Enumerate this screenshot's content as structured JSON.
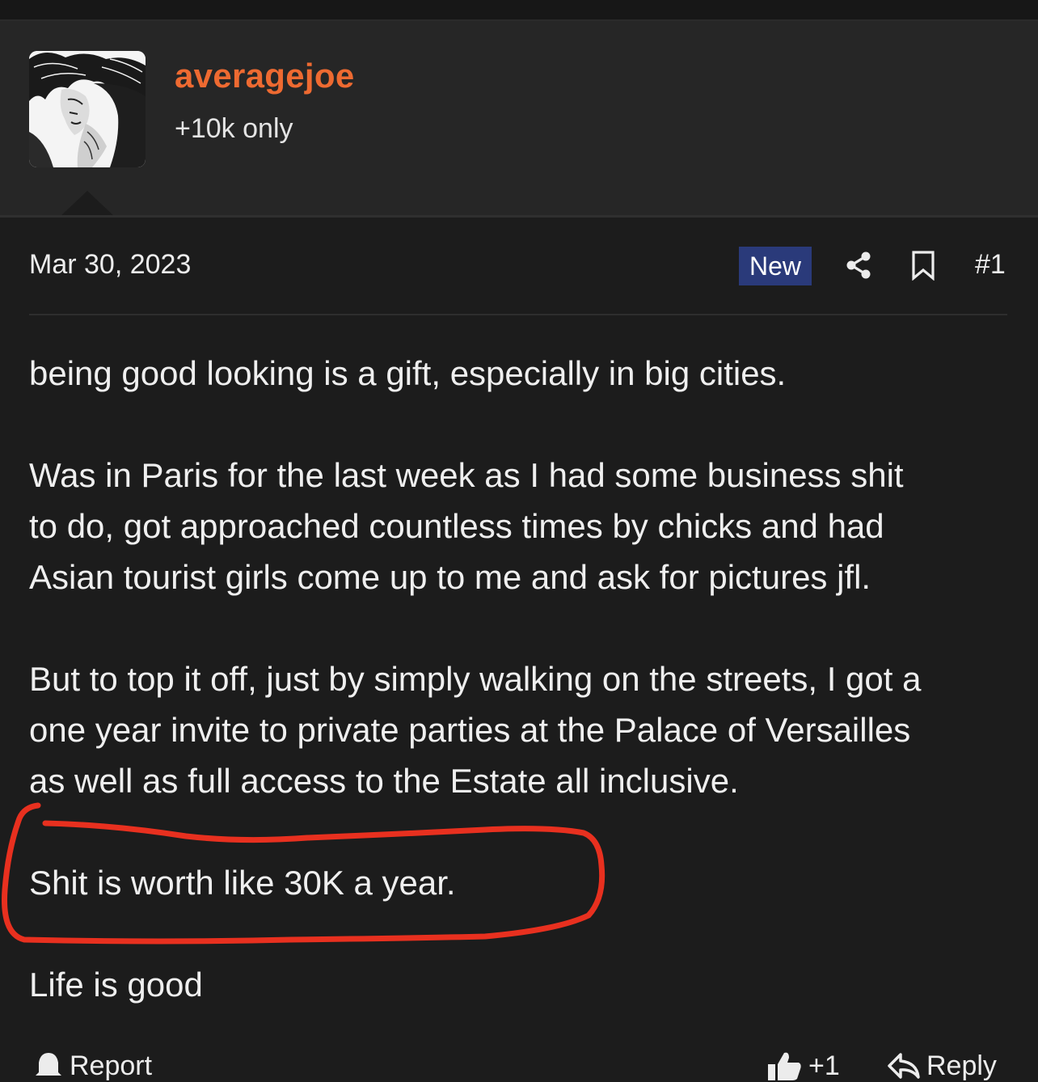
{
  "user": {
    "name": "averagejoe",
    "title": "+10k only",
    "name_color": "#ee6a31"
  },
  "post": {
    "date": "Mar 30, 2023",
    "new_badge": "New",
    "number": "#1",
    "paragraphs": [
      "being good looking is a gift, especially in big cities.",
      "Was in Paris for the last week as I had some business shit",
      "to do, got approached countless times by chicks and had",
      "Asian tourist girls come up to me and ask for pictures jfl.",
      "But to top it off, just by simply walking on the streets, I got a",
      "one year invite to private parties at the Palace of Versailles",
      "as well as full access to the Estate all inclusive.",
      "Shit is worth like 30K a year.",
      "Life is good"
    ]
  },
  "icons": {
    "share": "share-icon",
    "bookmark": "bookmark-icon",
    "report": "bell-icon",
    "reaction": "thumbs-up-icon",
    "reply": "reply-icon"
  },
  "footer": {
    "report_label": "Report",
    "reaction_count": "+1",
    "reply_label": "Reply"
  },
  "colors": {
    "background": "#1c1c1c",
    "header_bg": "#262626",
    "badge_bg": "#2a3a7a",
    "annotation": "#e8301f"
  }
}
